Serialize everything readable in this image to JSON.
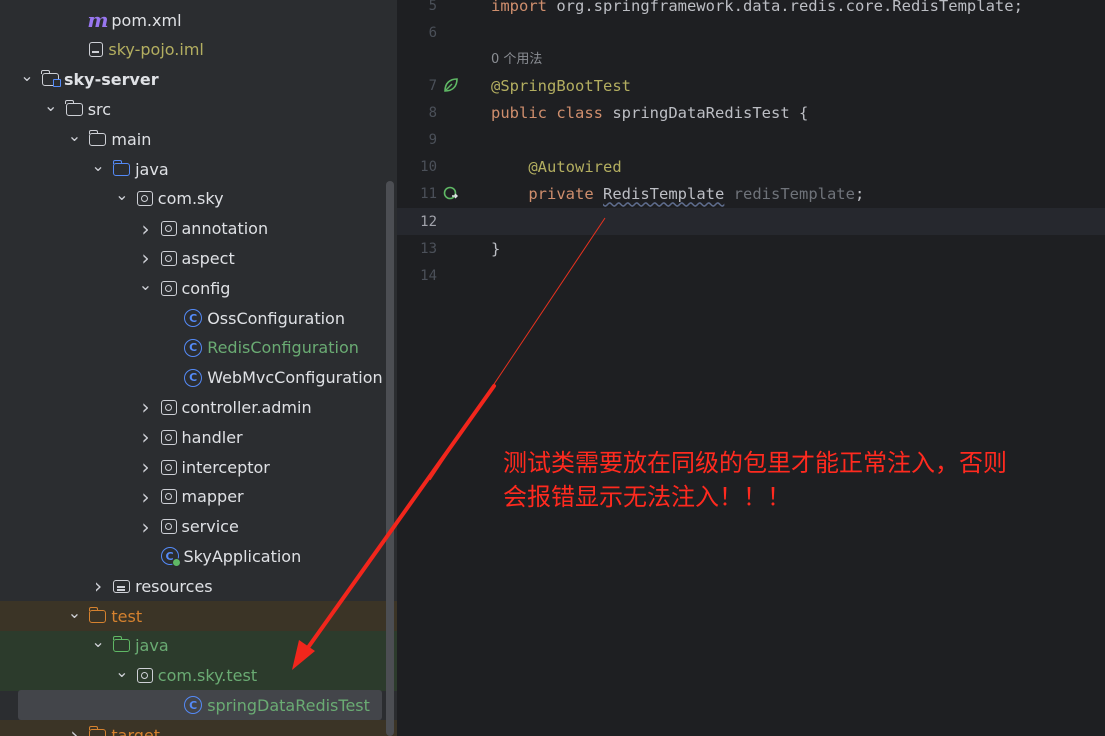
{
  "project_tree": [
    {
      "label": "pom.xml",
      "icon": "maven-icon",
      "depth": 3,
      "chevron": "none",
      "color": "#dfe1e5"
    },
    {
      "label": "sky-pojo.iml",
      "icon": "iml-file-icon",
      "depth": 3,
      "chevron": "none",
      "color": "#b3ae60"
    },
    {
      "label": "sky-server",
      "icon": "module-folder-icon",
      "depth": 1,
      "chevron": "open",
      "color": "#dfe1e5",
      "bold": true
    },
    {
      "label": "src",
      "icon": "folder-icon",
      "depth": 2,
      "chevron": "open",
      "color": "#dfe1e5"
    },
    {
      "label": "main",
      "icon": "folder-icon",
      "depth": 3,
      "chevron": "open",
      "color": "#dfe1e5"
    },
    {
      "label": "java",
      "icon": "source-folder-icon",
      "depth": 4,
      "chevron": "open",
      "color": "#dfe1e5"
    },
    {
      "label": "com.sky",
      "icon": "package-icon",
      "depth": 5,
      "chevron": "open",
      "color": "#dfe1e5"
    },
    {
      "label": "annotation",
      "icon": "package-icon",
      "depth": 6,
      "chevron": "closed",
      "color": "#dfe1e5"
    },
    {
      "label": "aspect",
      "icon": "package-icon",
      "depth": 6,
      "chevron": "closed",
      "color": "#dfe1e5"
    },
    {
      "label": "config",
      "icon": "package-icon",
      "depth": 6,
      "chevron": "open",
      "color": "#dfe1e5"
    },
    {
      "label": "OssConfiguration",
      "icon": "class-icon",
      "depth": 7,
      "chevron": "none",
      "color": "#dfe1e5"
    },
    {
      "label": "RedisConfiguration",
      "icon": "class-icon",
      "depth": 7,
      "chevron": "none",
      "color": "#6aab73"
    },
    {
      "label": "WebMvcConfiguration",
      "icon": "class-icon",
      "depth": 7,
      "chevron": "none",
      "color": "#dfe1e5"
    },
    {
      "label": "controller.admin",
      "icon": "package-icon",
      "depth": 6,
      "chevron": "closed",
      "color": "#dfe1e5"
    },
    {
      "label": "handler",
      "icon": "package-icon",
      "depth": 6,
      "chevron": "closed",
      "color": "#dfe1e5"
    },
    {
      "label": "interceptor",
      "icon": "package-icon",
      "depth": 6,
      "chevron": "closed",
      "color": "#dfe1e5"
    },
    {
      "label": "mapper",
      "icon": "package-icon",
      "depth": 6,
      "chevron": "closed",
      "color": "#dfe1e5"
    },
    {
      "label": "service",
      "icon": "package-icon",
      "depth": 6,
      "chevron": "closed",
      "color": "#dfe1e5"
    },
    {
      "label": "SkyApplication",
      "icon": "boot-class-icon",
      "depth": 6,
      "chevron": "none",
      "color": "#dfe1e5"
    },
    {
      "label": "resources",
      "icon": "resources-folder-icon",
      "depth": 4,
      "chevron": "closed",
      "color": "#dfe1e5"
    },
    {
      "label": "test",
      "icon": "orange-folder-icon",
      "depth": 3,
      "chevron": "open",
      "color": "#d6822f",
      "bg": "#3b3426"
    },
    {
      "label": "java",
      "icon": "test-folder-icon",
      "depth": 4,
      "chevron": "open",
      "color": "#6aab73",
      "bg": "#2c3b2c"
    },
    {
      "label": "com.sky.test",
      "icon": "package-icon",
      "depth": 5,
      "chevron": "open",
      "color": "#6aab73",
      "bg": "#2c3b2c"
    },
    {
      "label": "springDataRedisTest",
      "icon": "class-icon",
      "depth": 7,
      "chevron": "none",
      "color": "#6aab73",
      "bg": "#43454a",
      "selected": true
    },
    {
      "label": "target",
      "icon": "orange-folder-icon",
      "depth": 3,
      "chevron": "closed",
      "color": "#d6822f",
      "bg": "#3b3426"
    }
  ],
  "editor": {
    "inlay_hint": "0 个用法",
    "lines": [
      {
        "num": "5",
        "tokens": [
          {
            "t": "import",
            "c": "kw"
          },
          {
            "t": " org.springframework.data.redis.core.RedisTemplate;",
            "c": ""
          }
        ]
      },
      {
        "num": "6",
        "tokens": []
      },
      {
        "num": "7",
        "tokens": [
          {
            "t": "@SpringBootTest",
            "c": "ann"
          }
        ],
        "gutter_icon": "spring-bean-icon"
      },
      {
        "num": "8",
        "tokens": [
          {
            "t": "public",
            "c": "kw"
          },
          {
            "t": " ",
            "c": ""
          },
          {
            "t": "class",
            "c": "kw"
          },
          {
            "t": " springDataRedisTest {",
            "c": ""
          }
        ]
      },
      {
        "num": "9",
        "tokens": []
      },
      {
        "num": "10",
        "tokens": [
          {
            "t": "    ",
            "c": ""
          },
          {
            "t": "@Autowired",
            "c": "ann"
          }
        ]
      },
      {
        "num": "11",
        "tokens": [
          {
            "t": "    ",
            "c": ""
          },
          {
            "t": "private",
            "c": "kw"
          },
          {
            "t": " ",
            "c": ""
          },
          {
            "t": "RedisTemplate",
            "c": "typ"
          },
          {
            "t": " redisTemplate",
            "c": "muted"
          },
          {
            "t": ";",
            "c": ""
          }
        ],
        "gutter_icon": "autowired-navigate-icon"
      },
      {
        "num": "12",
        "tokens": [],
        "current": true
      },
      {
        "num": "13",
        "tokens": [
          {
            "t": "}",
            "c": ""
          }
        ]
      },
      {
        "num": "14",
        "tokens": []
      }
    ]
  },
  "annotation_note": {
    "line1": "测试类需要放在同级的包里才能正常注入，否则",
    "line2": "会报错显示无法注入！！！",
    "color": "#ff2a1f"
  }
}
